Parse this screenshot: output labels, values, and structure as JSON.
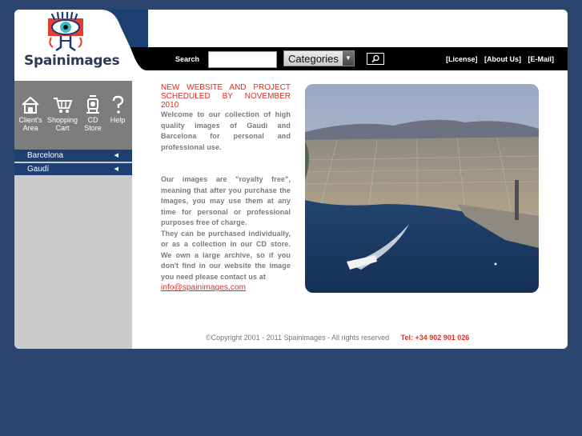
{
  "brand": {
    "name": "Spainimages"
  },
  "topbar": {
    "search_label": "Search",
    "search_value": "",
    "categories_label": "Categories",
    "links": [
      "[License]",
      "[About Us]",
      "[E-Mail]"
    ]
  },
  "sidebar": {
    "icons": [
      {
        "icon": "house-icon",
        "label_1": "Client's",
        "label_2": "Area"
      },
      {
        "icon": "shopping-cart-icon",
        "label_1": "Shopping",
        "label_2": "Cart"
      },
      {
        "icon": "cd-store-icon",
        "label_1": "CD",
        "label_2": "Store"
      },
      {
        "icon": "help-icon",
        "label_1": "Help",
        "label_2": ""
      }
    ],
    "nav": [
      "Barcelona",
      "Gaudí"
    ]
  },
  "main": {
    "headline": "NEW WEBSITE AND PROJECT SCHEDULED BY NOVEMBER 2010",
    "para1": "Welcome to our collection of high quality images of Gaudi and Barcelona for personal and professional use.",
    "para2": "Our images are \"royalty free\", meaning that after you purchase the Images, you may use them at any time for personal or professional purposes free of charge.",
    "para3": "They can be purchased individually, or as a collection in our CD store. We own a large archive, so if you don't find in our website the image you need please contact us at",
    "email": "info@spainimages.com"
  },
  "footer": {
    "copyright": "©Copyright 2001 - 2011 Spainimages - All rights reserved",
    "tel": "Tel: +34 902 901 026"
  },
  "colors": {
    "background": "#2c4470",
    "accent_red": "#e52b1f",
    "nav_blue": "#1e3f72"
  }
}
